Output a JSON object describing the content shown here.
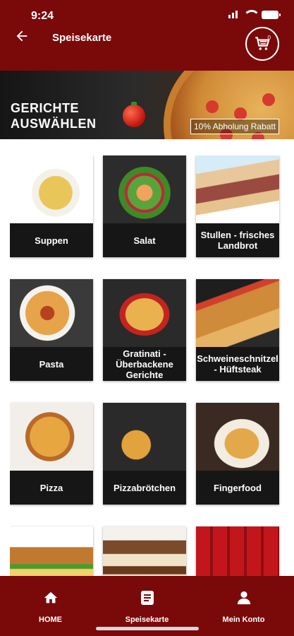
{
  "status_bar": {
    "time": "9:24"
  },
  "header": {
    "title": "Speisekarte",
    "cart_count": "0"
  },
  "banner": {
    "heading_line1": "GERICHTE",
    "heading_line2": "AUSWÄHLEN",
    "badge": "10% Abholung Rabatt"
  },
  "categories": [
    {
      "label": "Suppen"
    },
    {
      "label": "Salat"
    },
    {
      "label": "Stullen - frisches Landbrot"
    },
    {
      "label": "Pasta"
    },
    {
      "label": "Gratinati - Überbackene Gerichte"
    },
    {
      "label": "Schweineschnitzel - Hüftsteak"
    },
    {
      "label": "Pizza"
    },
    {
      "label": "Pizzabrötchen"
    },
    {
      "label": "Fingerfood"
    },
    {
      "label": ""
    },
    {
      "label": ""
    },
    {
      "label": ""
    }
  ],
  "bottom_nav": {
    "home_label": "HOME",
    "menu_label": "Speisekarte",
    "account_label": "Mein Konto"
  },
  "colors": {
    "brand": "#7a0a0a",
    "card_label_bg": "#161616"
  }
}
